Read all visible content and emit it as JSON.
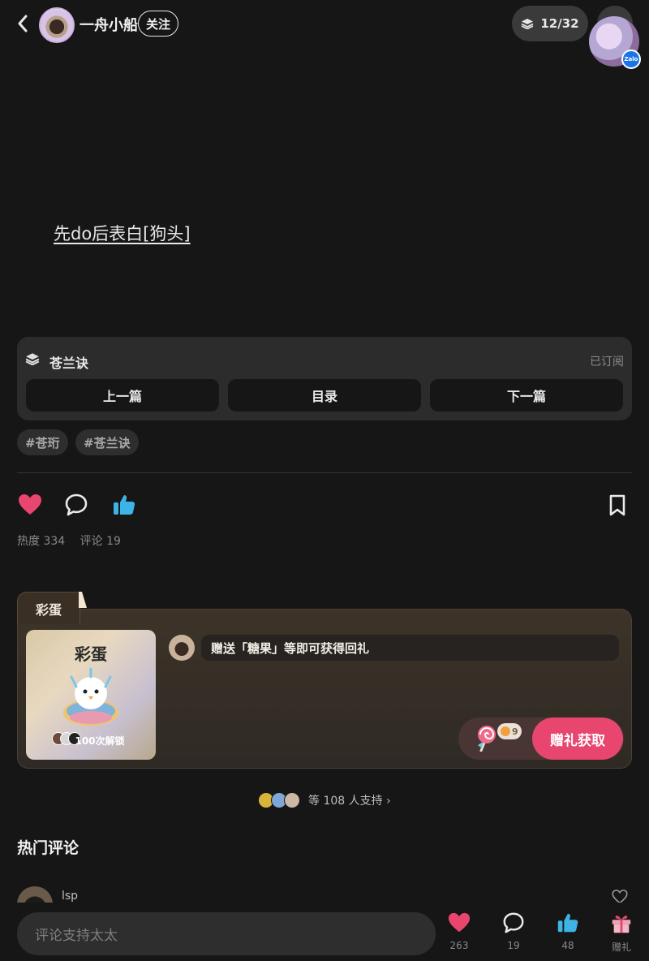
{
  "header": {
    "author_name": "一舟小船",
    "follow_label": "关注",
    "page_indicator": "12/32",
    "floating_app_badge": "Zalo"
  },
  "post": {
    "text": "先do后表白[狗头]"
  },
  "collection": {
    "title": "苍兰诀",
    "status": "已订阅",
    "prev_label": "上一篇",
    "toc_label": "目录",
    "next_label": "下一篇"
  },
  "tags": [
    "#苍珩",
    "#苍兰诀"
  ],
  "stats": {
    "heat": "热度 334",
    "comments": "评论 19"
  },
  "easter_egg": {
    "tab_label": "彩蛋",
    "card_title": "彩蛋",
    "card_footer": "100次解锁",
    "gift_message": "赠送「糖果」等即可获得回礼",
    "candy_count": "9",
    "gift_button": "赠礼获取"
  },
  "supporters": {
    "text": "等 108 人支持 ›"
  },
  "comments": {
    "section_title": "热门评论",
    "first_user": "lsp"
  },
  "bottom_bar": {
    "input_placeholder": "评论支持太太",
    "like_count": "263",
    "comment_count": "19",
    "recommend_count": "48",
    "gift_label": "赠礼"
  },
  "colors": {
    "background": "#161616",
    "heart": "#e8456f",
    "thumb": "#3cb4e6",
    "gift_button": "#e8456f"
  }
}
